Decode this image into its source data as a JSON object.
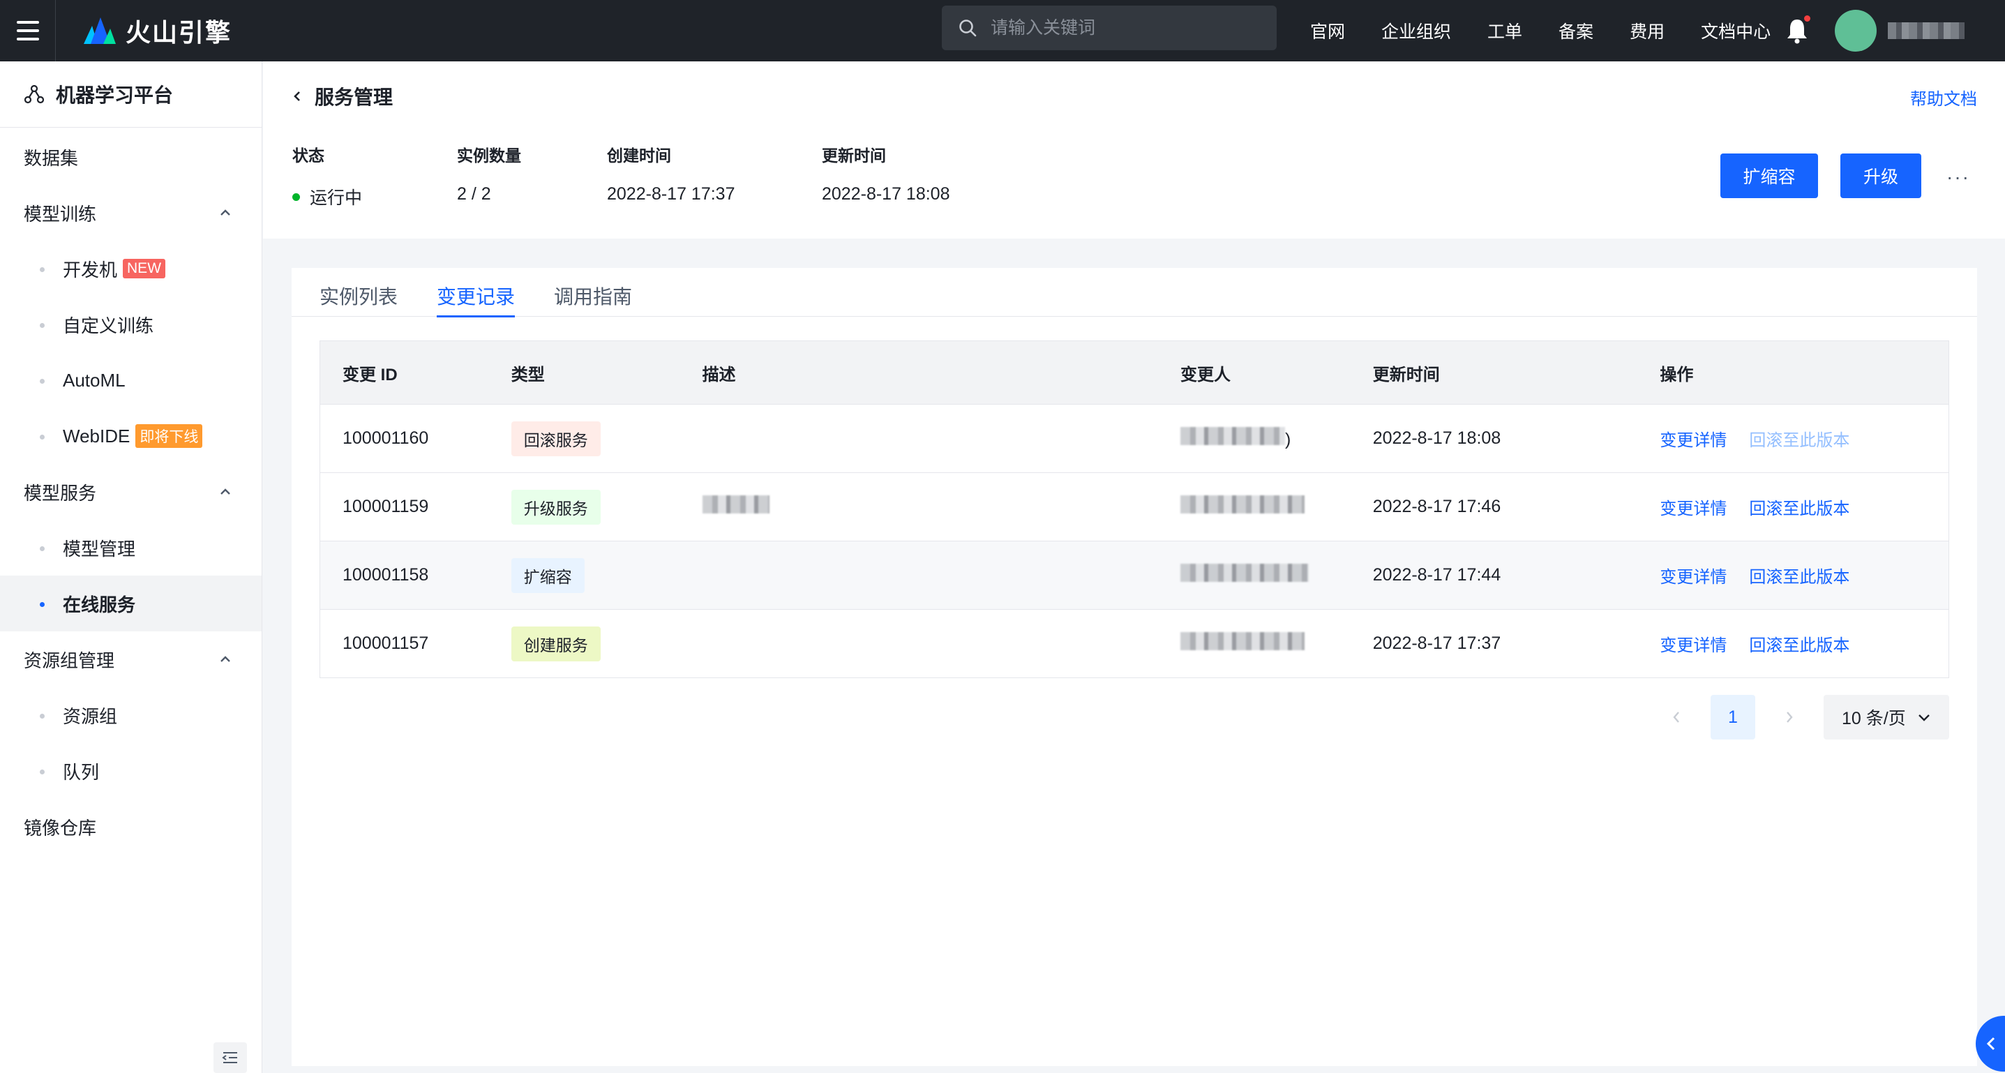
{
  "topbar": {
    "brand": "火山引擎",
    "search_placeholder": "请输入关键词",
    "nav": [
      "官网",
      "企业组织",
      "工单",
      "备案",
      "费用",
      "文档中心"
    ]
  },
  "sidebar": {
    "title": "机器学习平台",
    "items": [
      {
        "label": "数据集"
      },
      {
        "label": "模型训练"
      },
      {
        "label": "开发机",
        "badge": "NEW"
      },
      {
        "label": "自定义训练"
      },
      {
        "label": "AutoML"
      },
      {
        "label": "WebIDE",
        "badge": "即将下线"
      },
      {
        "label": "模型服务"
      },
      {
        "label": "模型管理"
      },
      {
        "label": "在线服务"
      },
      {
        "label": "资源组管理"
      },
      {
        "label": "资源组"
      },
      {
        "label": "队列"
      },
      {
        "label": "镜像仓库"
      }
    ]
  },
  "header": {
    "title": "服务管理",
    "help": "帮助文档",
    "status_label": "状态",
    "status_value": "运行中",
    "instances_label": "实例数量",
    "instances_value": "2 / 2",
    "created_label": "创建时间",
    "created_value": "2022-8-17 17:37",
    "updated_label": "更新时间",
    "updated_value": "2022-8-17 18:08",
    "scale_button": "扩缩容",
    "upgrade_button": "升级",
    "more": "···"
  },
  "tabs": [
    "实例列表",
    "变更记录",
    "调用指南"
  ],
  "table": {
    "headers": [
      "变更 ID",
      "类型",
      "描述",
      "变更人",
      "更新时间",
      "操作"
    ],
    "rows": [
      {
        "id": "100001160",
        "type": "回滚服务",
        "time": "2022-8-17 18:08",
        "detail": "变更详情",
        "rollback": "回滚至此版本",
        "person_suffix": ")"
      },
      {
        "id": "100001159",
        "type": "升级服务",
        "time": "2022-8-17 17:46",
        "detail": "变更详情",
        "rollback": "回滚至此版本",
        "person_suffix": ""
      },
      {
        "id": "100001158",
        "type": "扩缩容",
        "time": "2022-8-17 17:44",
        "detail": "变更详情",
        "rollback": "回滚至此版本",
        "person_suffix": ""
      },
      {
        "id": "100001157",
        "type": "创建服务",
        "time": "2022-8-17 17:37",
        "detail": "变更详情",
        "rollback": "回滚至此版本",
        "person_suffix": ""
      }
    ]
  },
  "pagination": {
    "page": "1",
    "page_size": "10 条/页"
  },
  "colors": {
    "primary": "#1664ff",
    "running": "#00b42a",
    "rollback_tag_bg": "#ffece8",
    "upgrade_tag_bg": "#e8ffea",
    "scale_tag_bg": "#e8f3ff",
    "create_tag_bg": "#edf8c5"
  }
}
